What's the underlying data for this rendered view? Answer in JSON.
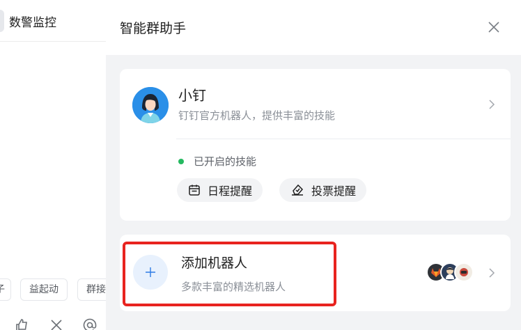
{
  "left_pane": {
    "title": "数警监控",
    "chips": [
      "子",
      "益起动",
      "群接"
    ]
  },
  "drawer": {
    "title": "智能群助手",
    "robot_card": {
      "name": "小钉",
      "description": "钉钉官方机器人，提供丰富的技能",
      "skills_status": "已开启的技能",
      "status_color": "#25b960",
      "skills": [
        {
          "label": "日程提醒",
          "icon": "calendar-icon"
        },
        {
          "label": "投票提醒",
          "icon": "vote-icon"
        }
      ]
    },
    "add_card": {
      "title": "添加机器人",
      "description": "多款丰富的精选机器人",
      "accent": "#2d7be5"
    },
    "highlight_color": "#e8231f"
  }
}
